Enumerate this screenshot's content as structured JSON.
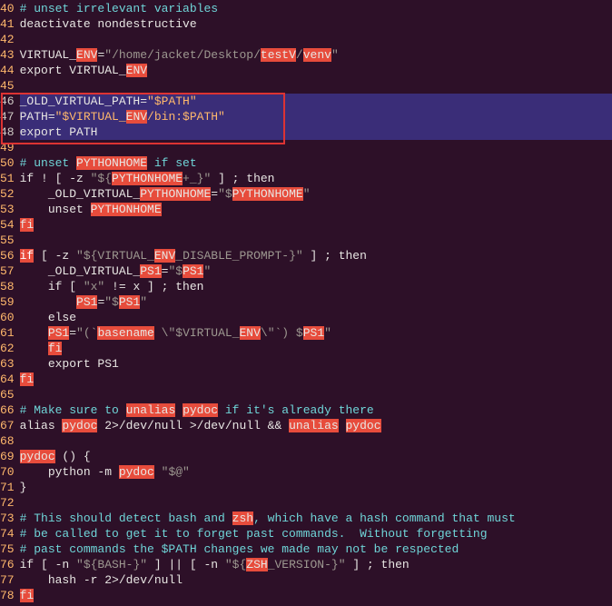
{
  "gutter": [
    "40",
    "41",
    "42",
    "43",
    "44",
    "45",
    "46",
    "47",
    "48",
    "49",
    "50",
    "51",
    "52",
    "53",
    "54",
    "55",
    "56",
    "57",
    "58",
    "59",
    "60",
    "61",
    "62",
    "63",
    "64",
    "65",
    "66",
    "67",
    "68",
    "69",
    "70",
    "71",
    "72",
    "73",
    "74",
    "75",
    "76",
    "77",
    "78"
  ],
  "hl_keywords": {
    "ENV": "ENV",
    "PYTHONHOME": "PYTHONHOME",
    "fi": "fi",
    "if": "if",
    "basename": "basename",
    "unalias": "unalias",
    "pydoc": "pydoc",
    "zsh": "zsh",
    "ZSH": "ZSH",
    "PS1": "PS1",
    "testV": "testV",
    "venv": "venv"
  },
  "t": {
    "l40_a": "# unset irrelevant variables",
    "l41_a": "deactivate nondestructive",
    "l43_a": "VIRTUAL_",
    "l43_b": "=",
    "l43_c": "\"",
    "l43_d": "/home/jacket/Desktop/",
    "l43_s": "/",
    "l44_a": "export VIRTUAL_",
    "l46_a": "_OLD_VIRTUAL_PATH=",
    "l46_b": "\"$PATH\"",
    "l47_a": "PATH=",
    "l47_b": "\"$VIRTUAL_",
    "l47_c": "/bin:$PATH\"",
    "l48_a": "export PATH",
    "l50_a": "# unset ",
    "l50_b": " if set",
    "l51_a": "if [ ! [ -z ",
    "l51_alt": "if ! [ -z ",
    "l51_b": "\"${",
    "l51_c": "+_}\"",
    "l51_d": " ] ; then",
    "l52_a": "    _OLD_VIRTUAL_",
    "l52_b": "=",
    "l52_c": "\"$",
    "l53_a": "    unset ",
    "l56_a": " [ -z ",
    "l56_b": "\"${VIRTUAL_",
    "l56_c": "_DISABLE_PROMPT-}\"",
    "l56_d": " ] ; then",
    "l57_a": "    _OLD_VIRTUAL_",
    "l57_b": "=",
    "l57_c": "\"$",
    "l58_a": "    if [ ",
    "l58_b": "\"x\"",
    "l58_c": " != x ] ; then",
    "l59_a": "        ",
    "l59_b": "=",
    "l59_c": "\"$",
    "l60_a": "    else",
    "l61_a": "    ",
    "l61_b": "=",
    "l61_c": "\"(`",
    "l61_d": " \\\"$VIRTUAL_",
    "l61_e": "\\\"`) $",
    "l62_a": "    ",
    "l63_a": "    export PS1",
    "l66_a": "# Make sure to ",
    "l66_b": " if it's already there",
    "l67_a": "alias ",
    "l67_b": " 2>/dev/null >/dev/null && ",
    "l69_a": " () {",
    "l70_a": "    python -m ",
    "l70_b": " ",
    "l70_c": "\"$@\"",
    "l71_a": "}",
    "l73_a": "# This should detect bash and ",
    "l73_b": ", which have a hash command that must",
    "l74_a": "# be called to get it to forget past commands.  Without forgetting",
    "l75_a": "# past commands the $PATH changes we made may not be respected",
    "l76_a": "if [ -n ",
    "l76_b": "\"${BASH-}\"",
    "l76_c": " ] || [ -n ",
    "l76_d": "\"${",
    "l76_e": "_VERSION-}\"",
    "l76_f": " ] ; then",
    "l77_a": "    hash -r 2>/dev/null"
  }
}
